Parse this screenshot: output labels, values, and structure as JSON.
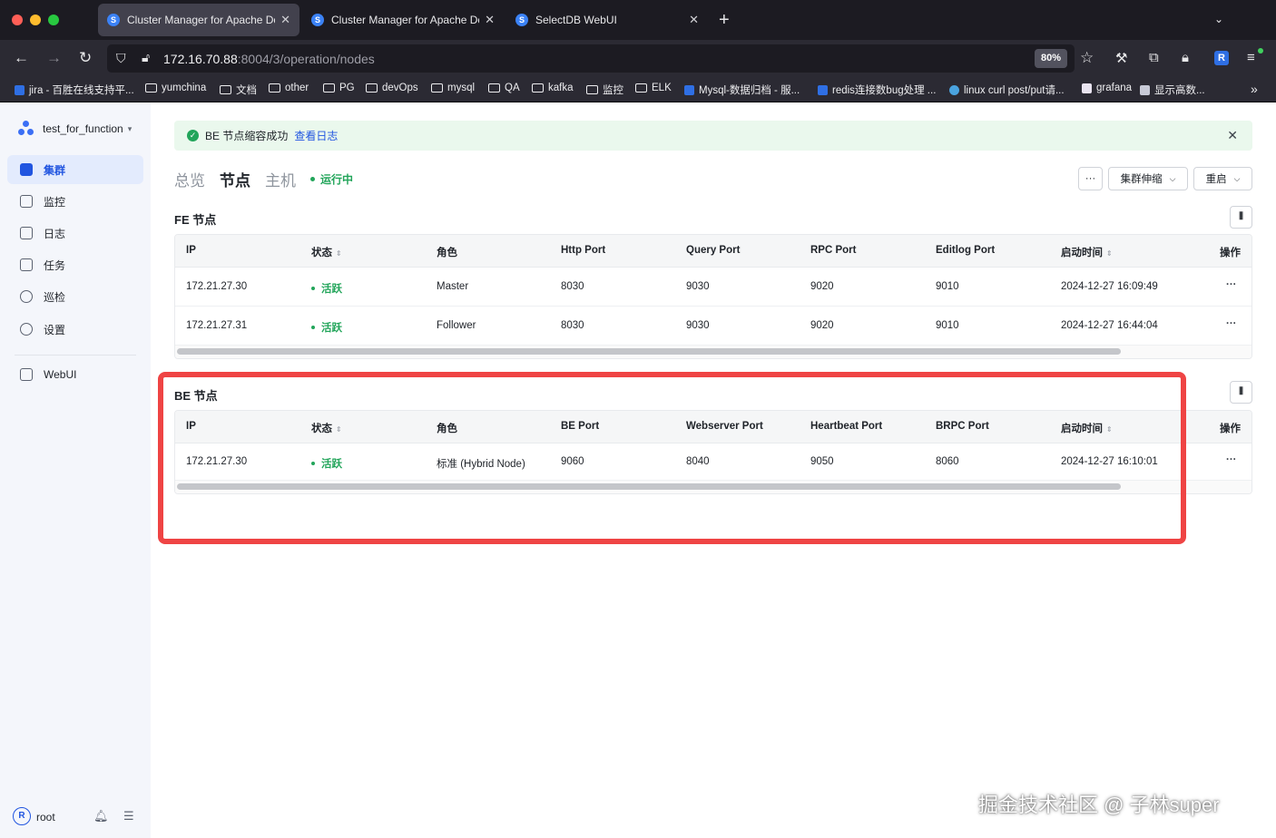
{
  "browser": {
    "tabs": [
      {
        "label": "Cluster Manager for Apache Doris",
        "active": true
      },
      {
        "label": "Cluster Manager for Apache Doris",
        "active": false
      },
      {
        "label": "SelectDB WebUI",
        "active": false
      }
    ],
    "url_host": "172.16.70.88",
    "url_rest": ":8004/3/operation/nodes",
    "zoom": "80%",
    "extension_badge": "R",
    "bookmarks": [
      {
        "label": "jira - 百胜在线支持平...",
        "kind": "site",
        "color": "#2f6fe4"
      },
      {
        "label": "yumchina",
        "kind": "folder"
      },
      {
        "label": "文档",
        "kind": "folder"
      },
      {
        "label": "other",
        "kind": "folder"
      },
      {
        "label": "PG",
        "kind": "folder"
      },
      {
        "label": "devOps",
        "kind": "folder"
      },
      {
        "label": "mysql",
        "kind": "folder"
      },
      {
        "label": "QA",
        "kind": "folder"
      },
      {
        "label": "kafka",
        "kind": "folder"
      },
      {
        "label": "监控",
        "kind": "folder"
      },
      {
        "label": "ELK",
        "kind": "folder"
      },
      {
        "label": "Mysql-数据归档 - 服...",
        "kind": "site",
        "color": "#2f6fe4"
      },
      {
        "label": "redis连接数bug处理 ...",
        "kind": "site",
        "color": "#2f6fe4"
      },
      {
        "label": "linux curl post/put请...",
        "kind": "site",
        "color": "#4aa3df"
      },
      {
        "label": "grafana",
        "kind": "site",
        "color": "#e9e4f0"
      },
      {
        "label": "显示高数...",
        "kind": "site",
        "color": "#c7c9d6"
      }
    ]
  },
  "sidebar": {
    "cluster_name": "test_for_function",
    "items": [
      {
        "label": "集群",
        "icon": "cluster-icon",
        "active": true
      },
      {
        "label": "监控",
        "icon": "monitor-icon",
        "active": false
      },
      {
        "label": "日志",
        "icon": "log-icon",
        "active": false
      },
      {
        "label": "任务",
        "icon": "task-icon",
        "active": false
      },
      {
        "label": "巡检",
        "icon": "inspection-icon",
        "active": false
      },
      {
        "label": "设置",
        "icon": "settings-icon",
        "active": false
      }
    ],
    "webui_label": "WebUI",
    "user": {
      "avatar": "R",
      "name": "root"
    }
  },
  "alert": {
    "message": "BE 节点缩容成功",
    "link": "查看日志"
  },
  "page": {
    "tabs": [
      {
        "label": "总览",
        "active": false
      },
      {
        "label": "节点",
        "active": true
      },
      {
        "label": "主机",
        "active": false
      }
    ],
    "status": "运行中",
    "more_button": "···",
    "scale_button": "集群伸缩",
    "restart_button": "重启"
  },
  "fe": {
    "title": "FE 节点",
    "columns": [
      "IP",
      "状态",
      "角色",
      "Http Port",
      "Query Port",
      "RPC Port",
      "Editlog Port",
      "启动时间",
      "操作"
    ],
    "rows": [
      [
        "172.21.27.30",
        "活跃",
        "Master",
        "8030",
        "9030",
        "9020",
        "9010",
        "2024-12-27 16:09:49",
        "···"
      ],
      [
        "172.21.27.31",
        "活跃",
        "Follower",
        "8030",
        "9030",
        "9020",
        "9010",
        "2024-12-27 16:44:04",
        "···"
      ]
    ]
  },
  "be": {
    "title": "BE 节点",
    "columns": [
      "IP",
      "状态",
      "角色",
      "BE Port",
      "Webserver Port",
      "Heartbeat Port",
      "BRPC Port",
      "启动时间",
      "操作"
    ],
    "rows": [
      [
        "172.21.27.30",
        "活跃",
        "标准 (Hybrid Node)",
        "9060",
        "8040",
        "9050",
        "8060",
        "2024-12-27 16:10:01",
        "···"
      ]
    ]
  },
  "watermark": "掘金技术社区 @ 子林super",
  "colors": {
    "accent": "#2155e0",
    "success": "#22a55a",
    "highlight": "#ef4444"
  }
}
